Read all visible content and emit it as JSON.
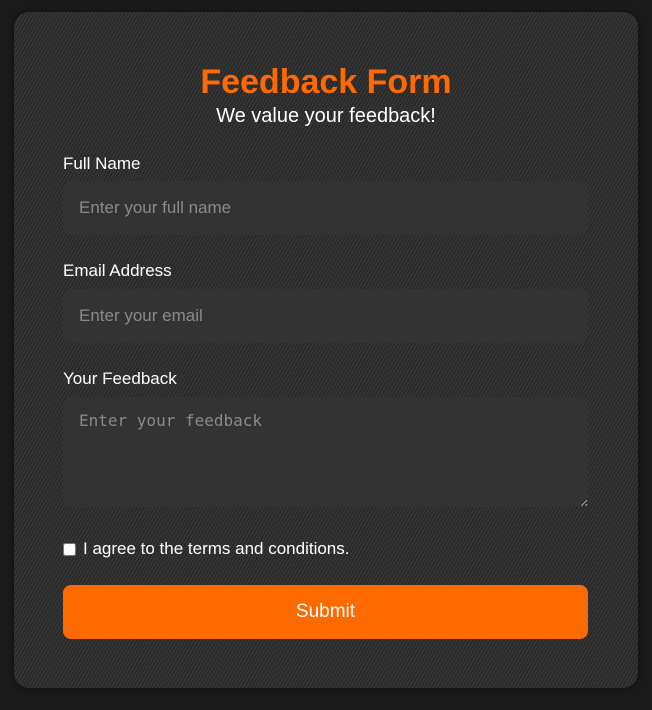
{
  "form": {
    "title": "Feedback Form",
    "subtitle": "We value your feedback!",
    "fields": {
      "name": {
        "label": "Full Name",
        "placeholder": "Enter your full name",
        "value": ""
      },
      "email": {
        "label": "Email Address",
        "placeholder": "Enter your email",
        "value": ""
      },
      "feedback": {
        "label": "Your Feedback",
        "placeholder": "Enter your feedback",
        "value": ""
      }
    },
    "terms_label": "I agree to the terms and conditions.",
    "terms_checked": false,
    "submit_label": "Submit"
  },
  "colors": {
    "accent": "#ff6a00",
    "card_background": "#2e2e2e",
    "page_background": "#1a1a1a",
    "field_background": "#333333",
    "text": "#ffffff"
  }
}
